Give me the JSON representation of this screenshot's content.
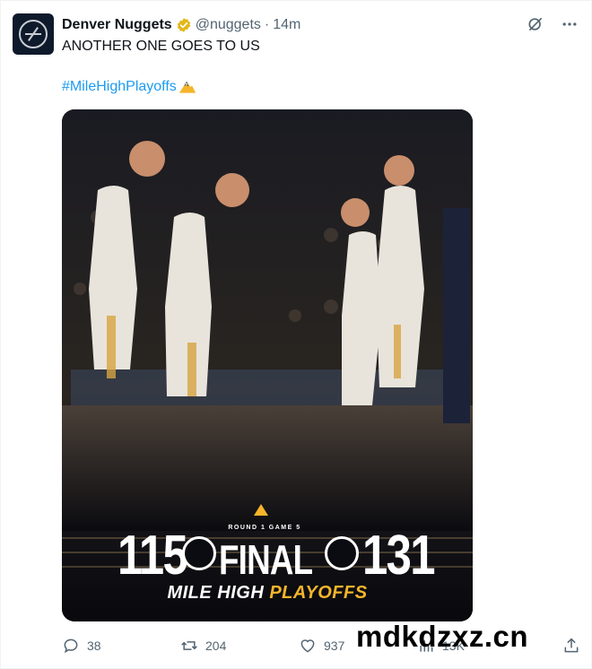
{
  "tweet": {
    "author_name": "Denver Nuggets",
    "handle": "@nuggets",
    "separator": "·",
    "time": "14m",
    "text": "ANOTHER ONE GOES TO US",
    "hashtag": "#MileHighPlayoffs"
  },
  "media": {
    "round_label": "ROUND 1 GAME 5",
    "score_home": "115",
    "final_label": "FINAL",
    "score_away": "131",
    "banner_white": "MILE HIGH ",
    "banner_yellow": "PLAYOFFS",
    "colors": {
      "accent_yellow": "#f5b52b",
      "navy": "#0e1a2b"
    }
  },
  "actions": {
    "replies": "38",
    "retweets": "204",
    "likes": "937",
    "views": "13K"
  },
  "watermark": "mdkdzxz.cn",
  "icons": [
    "grok-icon",
    "more-icon",
    "reply-icon",
    "retweet-icon",
    "like-icon",
    "views-icon",
    "share-icon",
    "verified-icon",
    "mountain-emoji-icon"
  ]
}
